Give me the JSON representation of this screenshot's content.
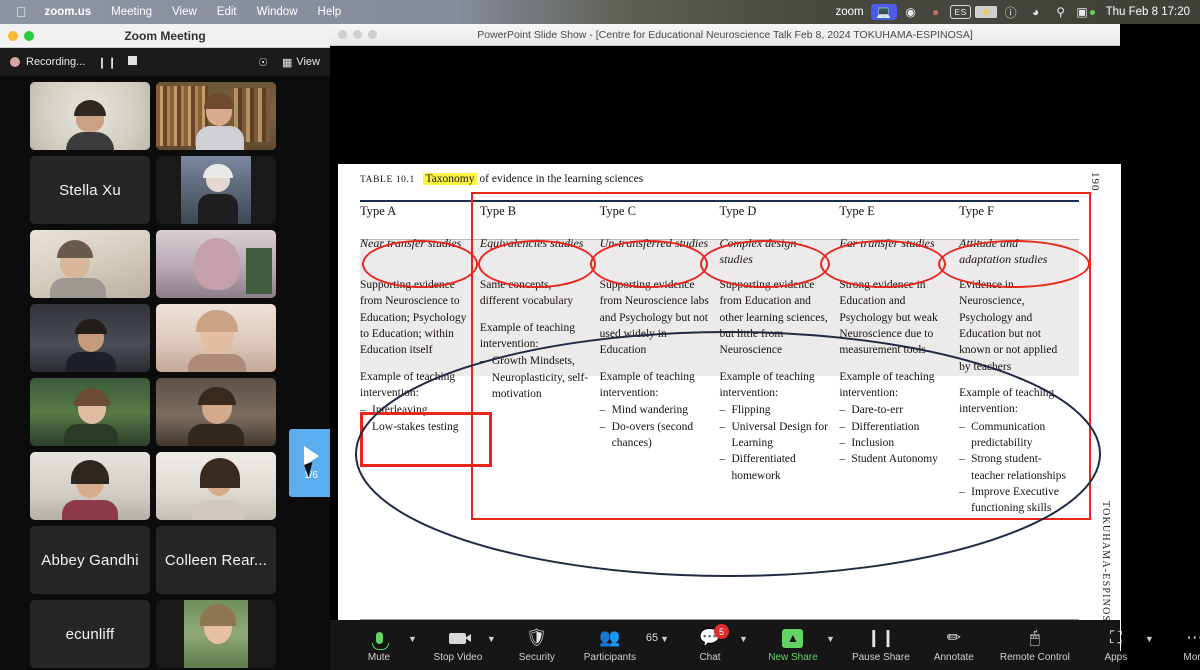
{
  "menubar": {
    "apple_icon": "apple-logo",
    "items": [
      "zoom.us",
      "Meeting",
      "View",
      "Edit",
      "Window",
      "Help"
    ],
    "right": {
      "app_label": "zoom",
      "screen_share_icon": "screen-share-icon",
      "control_center_icon": "control-center-icon",
      "shield_icon": "shield-icon",
      "input_source": "ES",
      "battery_icon": "battery-charging-icon",
      "siri_icon": "siri-icon",
      "wifi_icon": "wifi-icon",
      "spotlight_icon": "search-icon",
      "display_icon": "display-icon",
      "clock": "Thu Feb 8  17:20"
    }
  },
  "zoom_window": {
    "title": "Zoom Meeting",
    "recording_label": "Recording...",
    "pause_icon": "pause-icon",
    "stop_icon": "stop-icon",
    "lock_icon": "lock-icon",
    "view_label": "View",
    "view_icon": "grid-view-icon",
    "pager": {
      "play_icon": "play-arrow-icon",
      "page": "1/6"
    },
    "participants": [
      {
        "name": "",
        "video": true,
        "speaking": false
      },
      {
        "name": "",
        "video": true,
        "speaking": true
      },
      {
        "name": "Stella Xu",
        "video": false,
        "speaking": false
      },
      {
        "name": "",
        "video": true,
        "speaking": false
      },
      {
        "name": "",
        "video": true,
        "speaking": false
      },
      {
        "name": "",
        "video": true,
        "speaking": false
      },
      {
        "name": "",
        "video": true,
        "speaking": false
      },
      {
        "name": "",
        "video": true,
        "speaking": false
      },
      {
        "name": "",
        "video": true,
        "speaking": false
      },
      {
        "name": "",
        "video": true,
        "speaking": false
      },
      {
        "name": "Abbey Gandhi",
        "video": false,
        "speaking": false
      },
      {
        "name": "Colleen Rear...",
        "video": false,
        "speaking": false
      },
      {
        "name": "ecunliff",
        "video": false,
        "speaking": false
      },
      {
        "name": "",
        "video": true,
        "speaking": false
      }
    ]
  },
  "powerpoint": {
    "title": "PowerPoint Slide Show - [Centre for Educational Neuroscience Talk Feb 8, 2024 TOKUHAMA-ESPINOSA]",
    "slide": {
      "page_number": "190",
      "author_vertical": "TOKUHAMA-ESPINOSA",
      "table_label": "TABLE 10.1",
      "caption_highlight": "Taxonomy",
      "caption_rest": "of evidence in the learning sciences",
      "columns": [
        {
          "type": "Type A",
          "study": "Near transfer studies",
          "desc": "Supporting evidence from Neuroscience to Education; Psychology to Education; within Education itself",
          "example_label": "Example of teaching intervention:",
          "items": [
            "Interleaving",
            "Low-stakes testing"
          ]
        },
        {
          "type": "Type B",
          "study": "Equivalencies studies",
          "desc": "Same concepts, different vocabulary",
          "example_label": "Example of teaching intervention:",
          "items": [
            "Growth Mindsets, Neuroplasticity, self-motivation"
          ]
        },
        {
          "type": "Type C",
          "study": "Un-transferred studies",
          "desc": "Supporting evidence from Neuroscience labs and Psychology but not used widely in Education",
          "example_label": "Example of teaching intervention:",
          "items": [
            "Mind wandering",
            "Do-overs (second chances)"
          ]
        },
        {
          "type": "Type D",
          "study": "Complex design studies",
          "desc": "Supporting evidence from Education and other learning sciences, but little from Neuroscience",
          "example_label": "Example of teaching intervention:",
          "items": [
            "Flipping",
            "Universal Design for Learning",
            "Differentiated homework"
          ]
        },
        {
          "type": "Type E",
          "study": "Far transfer studies",
          "desc": "Strong evidence in Education and Psychology but weak Neuroscience due to measurement tools",
          "example_label": "Example of teaching intervention:",
          "items": [
            "Dare-to-err",
            "Differentiation",
            "Inclusion",
            "Student Autonomy"
          ]
        },
        {
          "type": "Type F",
          "study": "Attitude and adaptation studies",
          "desc": "Evidence in Neuroscience, Psychology and Education but not known or not applied by teachers",
          "example_label": "Example of teaching intervention:",
          "items": [
            "Communication predictability",
            "Strong student-teacher relationships",
            "Improve Executive functioning skills"
          ]
        }
      ],
      "annotation_color": "#e8261c"
    }
  },
  "toolbar": {
    "mute": {
      "label": "Mute",
      "icon": "microphone-icon",
      "has_caret": true
    },
    "stop_video": {
      "label": "Stop Video",
      "icon": "video-camera-icon",
      "has_caret": true
    },
    "security": {
      "label": "Security",
      "icon": "shield-icon",
      "has_caret": false
    },
    "participants": {
      "label": "Participants",
      "icon": "people-icon",
      "count": "65",
      "has_caret": true
    },
    "chat": {
      "label": "Chat",
      "icon": "chat-bubble-icon",
      "badge": "5",
      "has_caret": true
    },
    "new_share": {
      "label": "New Share",
      "icon": "share-up-arrow-icon",
      "has_caret": true,
      "color": "#63d463"
    },
    "pause_share": {
      "label": "Pause Share",
      "icon": "pause-icon",
      "has_caret": false
    },
    "annotate": {
      "label": "Annotate",
      "icon": "pencil-icon",
      "has_caret": false
    },
    "remote_control": {
      "label": "Remote Control",
      "icon": "mouse-icon",
      "has_caret": false
    },
    "apps": {
      "label": "Apps",
      "icon": "apps-icon",
      "has_caret": true
    },
    "more": {
      "label": "More",
      "icon": "ellipsis-icon",
      "has_caret": false
    }
  }
}
